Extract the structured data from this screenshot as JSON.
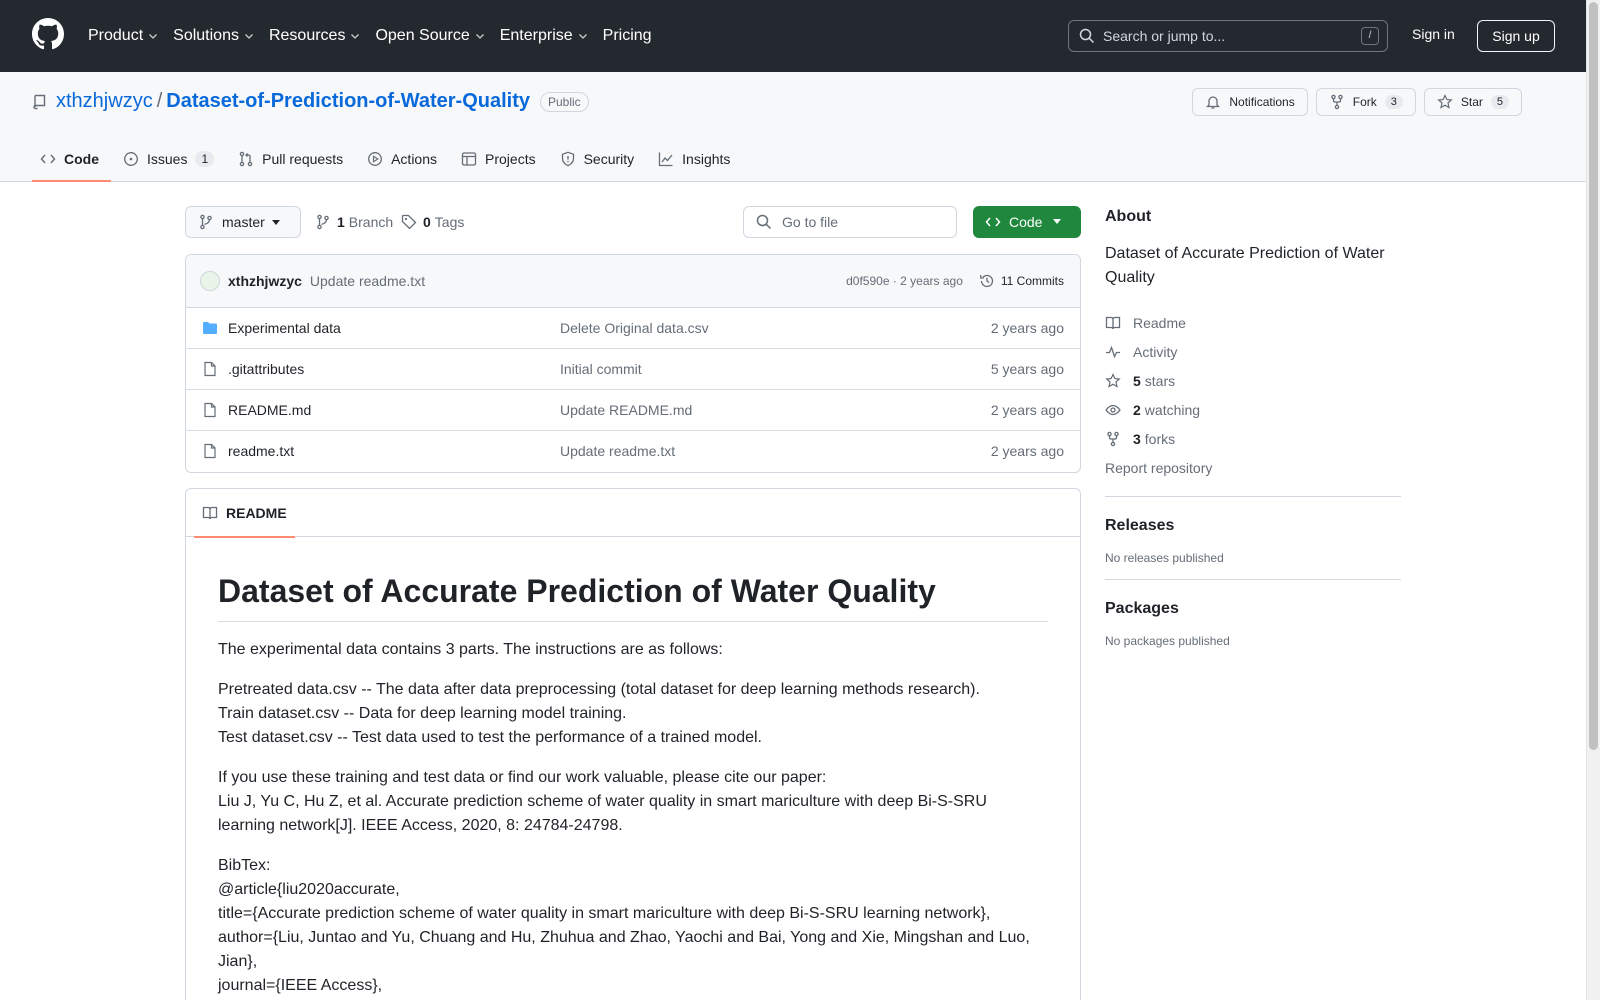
{
  "topnav": {
    "items": [
      "Product",
      "Solutions",
      "Resources",
      "Open Source",
      "Enterprise",
      "Pricing"
    ],
    "search_placeholder": "Search or jump to...",
    "search_shortcut": "/",
    "sign_in": "Sign in",
    "sign_up": "Sign up"
  },
  "repo": {
    "owner": "xthzhjwzyc",
    "separator": "/",
    "name": "Dataset-of-Prediction-of-Water-Quality",
    "visibility": "Public",
    "notifications_label": "Notifications",
    "fork_label": "Fork",
    "fork_count": "3",
    "star_label": "Star",
    "star_count": "5"
  },
  "tabs": [
    {
      "label": "Code"
    },
    {
      "label": "Issues",
      "count": "1"
    },
    {
      "label": "Pull requests"
    },
    {
      "label": "Actions"
    },
    {
      "label": "Projects"
    },
    {
      "label": "Security"
    },
    {
      "label": "Insights"
    }
  ],
  "toolbar": {
    "branch": "master",
    "branch_count": "1",
    "branch_label": "Branch",
    "tag_count": "0",
    "tag_label": "Tags",
    "go_to_file": "Go to file",
    "code_button": "Code"
  },
  "commit": {
    "author": "xthzhjwzyc",
    "message": "Update readme.txt",
    "meta": "d0f590e · 2 years ago",
    "commits": "11 Commits"
  },
  "files": [
    {
      "name": "Experimental data",
      "type": "folder",
      "message": "Delete Original data.csv",
      "time": "2 years ago"
    },
    {
      "name": ".gitattributes",
      "type": "file",
      "message": "Initial commit",
      "time": "5 years ago"
    },
    {
      "name": "README.md",
      "type": "file",
      "message": "Update README.md",
      "time": "2 years ago"
    },
    {
      "name": "readme.txt",
      "type": "file",
      "message": "Update readme.txt",
      "time": "2 years ago"
    }
  ],
  "readme": {
    "tab_label": "README",
    "title": "Dataset of Accurate Prediction of Water Quality",
    "intro": "The experimental data contains 3 parts. The instructions are as follows:",
    "lines1": [
      "Pretreated data.csv -- The data after data preprocessing (total dataset for deep learning methods research).",
      "Train dataset.csv -- Data for deep learning model training.",
      "Test dataset.csv -- Test data used to test the performance of a trained model."
    ],
    "cite_intro": "If you use these training and test data or find our work valuable, please cite our paper:",
    "cite_ref": "Liu J, Yu C, Hu Z, et al. Accurate prediction scheme of water quality in smart mariculture with deep Bi-S-SRU learning network[J]. IEEE Access, 2020, 8: 24784-24798.",
    "bibtex_lines": [
      "BibTex:",
      "@article{liu2020accurate,",
      "title={Accurate prediction scheme of water quality in smart mariculture with deep Bi-S-SRU learning network},",
      "author={Liu, Juntao and Yu, Chuang and Hu, Zhuhua and Zhao, Yaochi and Bai, Yong and Xie, Mingshan and Luo, Jian},",
      "journal={IEEE Access},"
    ]
  },
  "sidebar": {
    "about_title": "About",
    "description": "Dataset of Accurate Prediction of Water Quality",
    "readme": "Readme",
    "activity": "Activity",
    "stars_count": "5",
    "stars_label": "stars",
    "watching_count": "2",
    "watching_label": "watching",
    "forks_count": "3",
    "forks_label": "forks",
    "report": "Report repository",
    "releases_title": "Releases",
    "releases_text": "No releases published",
    "packages_title": "Packages",
    "packages_text": "No packages published"
  },
  "colors": {
    "header_bg": "#24292f",
    "link": "#0969da",
    "primary_button": "#1f883d",
    "active_tab_underline": "#fd8c73"
  }
}
